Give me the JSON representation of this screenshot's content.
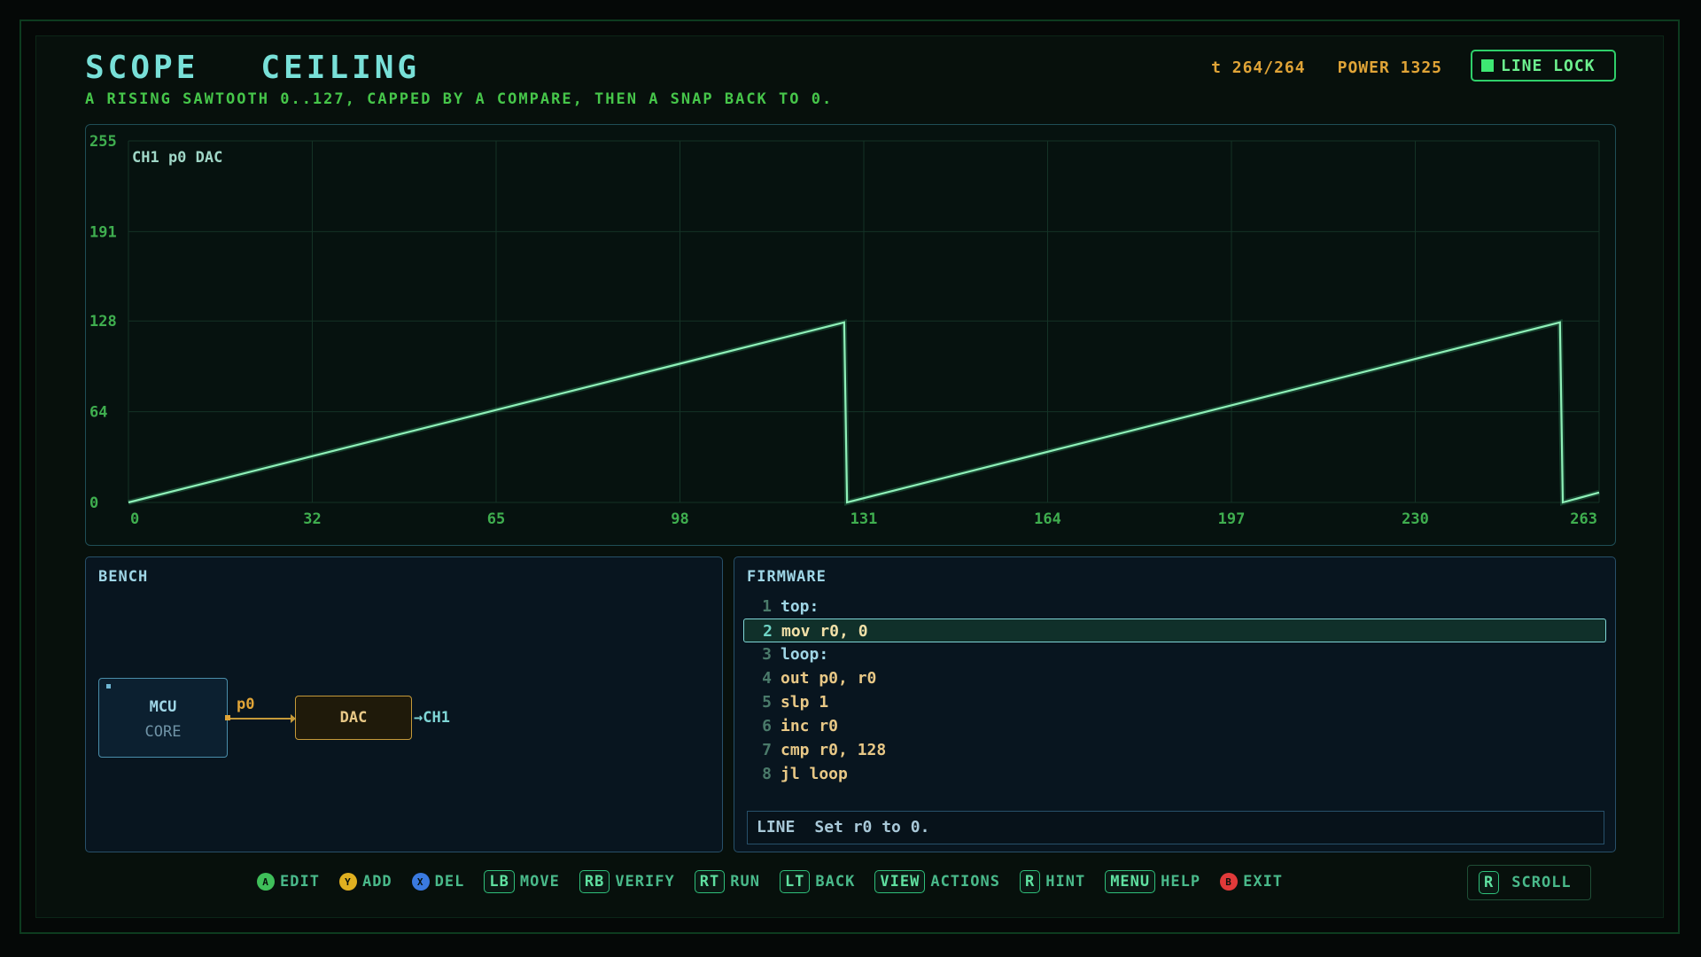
{
  "header": {
    "title_left": "SCOPE",
    "title_right": "CEILING",
    "subtitle": "A RISING SAWTOOTH 0..127, CAPPED BY A COMPARE, THEN A SNAP BACK TO 0.",
    "tick": "t 264/264",
    "power": "POWER 1325",
    "line_lock": "LINE LOCK"
  },
  "scope": {
    "channel_label": "CH1 p0 DAC"
  },
  "chart_data": {
    "type": "line",
    "y_ticks": [
      "255",
      "191",
      "128",
      "64",
      "0"
    ],
    "x_ticks": [
      "0",
      "32",
      "65",
      "98",
      "131",
      "164",
      "197",
      "230",
      "263"
    ],
    "xlim": [
      0,
      263
    ],
    "ylim": [
      0,
      255
    ],
    "grid": true,
    "series": [
      {
        "points": [
          [
            0,
            0
          ],
          [
            128,
            127
          ],
          [
            128.5,
            0
          ],
          [
            256,
            127
          ],
          [
            256.5,
            0
          ],
          [
            263,
            7
          ]
        ]
      }
    ],
    "color": "#8ff0b8"
  },
  "bench": {
    "title": "BENCH",
    "mcu_line1": "MCU",
    "mcu_line2": "CORE",
    "port": "p0",
    "dac": "DAC",
    "output": "CH1"
  },
  "firmware": {
    "title": "FIRMWARE",
    "lines": [
      {
        "n": "1",
        "text": "top:"
      },
      {
        "n": "2",
        "text": "mov r0, 0"
      },
      {
        "n": "3",
        "text": "loop:"
      },
      {
        "n": "4",
        "text": "out p0, r0"
      },
      {
        "n": "5",
        "text": "slp 1"
      },
      {
        "n": "6",
        "text": "inc r0"
      },
      {
        "n": "7",
        "text": "cmp r0, 128"
      },
      {
        "n": "8",
        "text": "jl loop"
      }
    ],
    "hint_key": "LINE",
    "hint_text": "Set r0 to 0."
  },
  "controls": {
    "edit": {
      "key": "A",
      "label": "EDIT",
      "color": "#3fbf5a"
    },
    "add": {
      "key": "Y",
      "label": "ADD",
      "color": "#e0b020"
    },
    "del": {
      "key": "X",
      "label": "DEL",
      "color": "#3a7ae0"
    },
    "move": {
      "key": "LB",
      "label": "MOVE"
    },
    "verify": {
      "key": "RB",
      "label": "VERIFY"
    },
    "run": {
      "key": "RT",
      "label": "RUN"
    },
    "back": {
      "key": "LT",
      "label": "BACK"
    },
    "actions": {
      "key": "VIEW",
      "label": "ACTIONS"
    },
    "hint": {
      "key": "R",
      "label": "HINT"
    },
    "help": {
      "key": "MENU",
      "label": "HELP"
    },
    "exit": {
      "key": "B",
      "label": "EXIT",
      "color": "#e03a3a"
    },
    "scroll": {
      "key": "R",
      "label": "SCROLL"
    }
  }
}
